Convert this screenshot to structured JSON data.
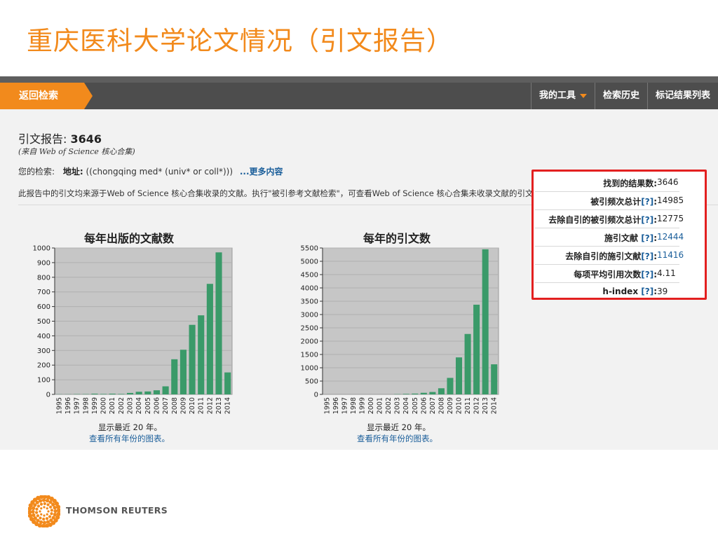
{
  "slide": {
    "title": "重庆医科大学论文情况（引文报告）"
  },
  "navbar": {
    "back_label": "返回检索",
    "my_tools_label": "我的工具",
    "history_label": "检索历史",
    "marked_label": "标记结果列表",
    "accent_color": "#f28a1c"
  },
  "report": {
    "title_prefix": "引文报告: ",
    "count": "3646",
    "source": "(来自 Web of Science 核心合集)",
    "search_prefix": "您的检索:",
    "address_label": "地址:",
    "query": "((chongqing med* (univ* or coll*)))",
    "more_link": "...更多内容",
    "note": "此报告中的引文均来源于Web of Science 核心合集收录的文献。执行\"被引参考文献检索\"，可查看Web of Science 核心合集未收录文献的引文。"
  },
  "chart_data": [
    {
      "type": "bar",
      "title": "每年出版的文献数",
      "categories": [
        "1995",
        "1996",
        "1997",
        "1998",
        "1999",
        "2000",
        "2001",
        "2002",
        "2003",
        "2004",
        "2005",
        "2006",
        "2007",
        "2008",
        "2009",
        "2010",
        "2011",
        "2012",
        "2013",
        "2014"
      ],
      "values": [
        1,
        1,
        2,
        2,
        5,
        3,
        5,
        3,
        10,
        18,
        20,
        28,
        55,
        240,
        305,
        475,
        540,
        755,
        970,
        150
      ],
      "ylim": [
        0,
        1000
      ],
      "yticks": [
        0,
        100,
        200,
        300,
        400,
        500,
        600,
        700,
        800,
        900,
        1000
      ],
      "bar_color": "#3a9a69",
      "plot_bg": "#c6c6c6",
      "grid": true,
      "caption": "显示最近 20 年。",
      "link": "查看所有年份的图表。"
    },
    {
      "type": "bar",
      "title": "每年的引文数",
      "categories": [
        "1995",
        "1996",
        "1997",
        "1998",
        "1999",
        "2000",
        "2001",
        "2002",
        "2003",
        "2004",
        "2005",
        "2006",
        "2007",
        "2008",
        "2009",
        "2010",
        "2011",
        "2012",
        "2013",
        "2014"
      ],
      "values": [
        0,
        0,
        0,
        0,
        0,
        0,
        0,
        0,
        10,
        20,
        30,
        60,
        90,
        230,
        620,
        1390,
        2270,
        3370,
        5450,
        1130
      ],
      "ylim": [
        0,
        5500
      ],
      "yticks": [
        0,
        500,
        1000,
        1500,
        2000,
        2500,
        3000,
        3500,
        4000,
        4500,
        5000,
        5500
      ],
      "bar_color": "#3a9a69",
      "plot_bg": "#c6c6c6",
      "grid": true,
      "caption": "显示最近 20 年。",
      "link": "查看所有年份的图表。"
    }
  ],
  "stats": {
    "help": "[?]",
    "rows": [
      {
        "label": "找到的结果数:",
        "value": "3646"
      },
      {
        "label": "被引频次总计",
        "value": "14985"
      },
      {
        "label": "去除自引的被引频次总计",
        "value": "12775"
      },
      {
        "label": "施引文献",
        "value": "12444"
      },
      {
        "label": "去除自引的施引文献",
        "value": "11416"
      },
      {
        "label": "每项平均引用次数",
        "value": "4.11"
      },
      {
        "label": "h-index",
        "value": "39"
      }
    ],
    "border_color": "#e32020"
  },
  "footer": {
    "brand": "THOMSON REUTERS"
  }
}
